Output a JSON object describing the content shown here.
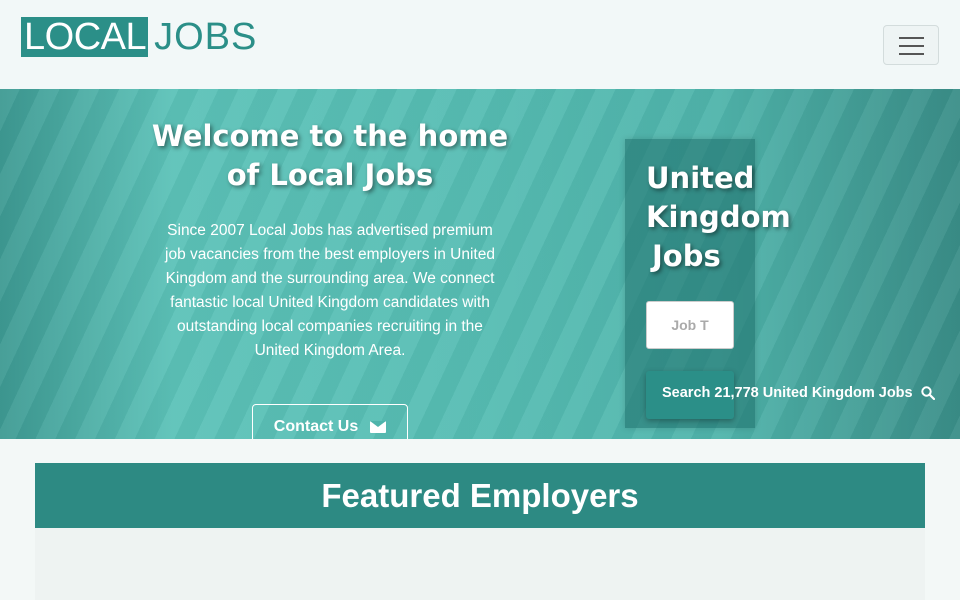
{
  "brand": {
    "logo_local": "LOCAL",
    "logo_jobs": "JOBS"
  },
  "hero": {
    "title": "Welcome to the home of Local Jobs",
    "description": "Since 2007 Local Jobs has advertised premium job vacancies from the best employers in United Kingdom and the surrounding area. We connect fantastic local United Kingdom candidates with outstanding local companies recruiting in the United Kingdom Area.",
    "contact_label": "Contact Us"
  },
  "search": {
    "title_line1": "United",
    "title_line2": "Kingdom",
    "title_line3": "Jobs",
    "input_placeholder": "Job T",
    "button_label": "Search 21,778 United Kingdom Jobs"
  },
  "featured": {
    "heading": "Featured Employers"
  },
  "icons": {
    "menu": "hamburger-icon",
    "contact": "envelope-icon",
    "search": "search-icon"
  },
  "colors": {
    "brand": "#2b8f88",
    "hero": "#56bdb3"
  }
}
